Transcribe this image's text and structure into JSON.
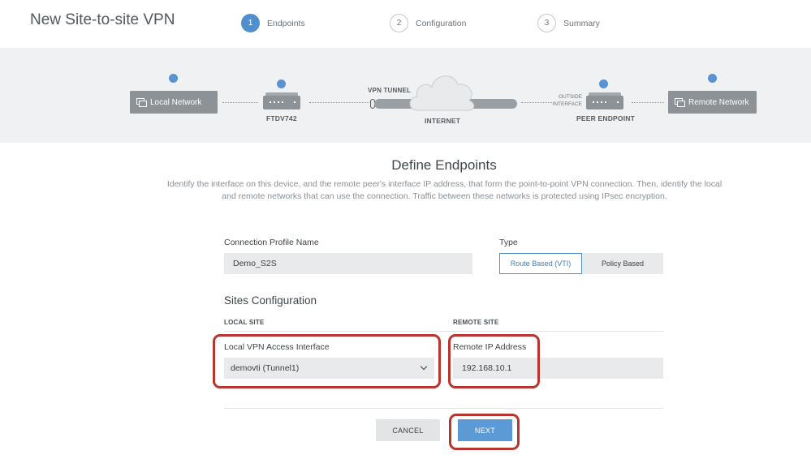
{
  "header": {
    "title": "New Site-to-site VPN",
    "steps": [
      {
        "number": "1",
        "label": "Endpoints",
        "active": true
      },
      {
        "number": "2",
        "label": "Configuration",
        "active": false
      },
      {
        "number": "3",
        "label": "Summary",
        "active": false
      }
    ]
  },
  "diagram": {
    "local_network": "Local Network",
    "local_device": "FTDV742",
    "tunnel_label": "VPN TUNNEL",
    "internet_label": "INTERNET",
    "outside_label_1": "OUTSIDE",
    "outside_label_2": "INTERFACE",
    "peer_label": "PEER ENDPOINT",
    "remote_network": "Remote Network"
  },
  "main": {
    "title": "Define Endpoints",
    "description": "Identify the interface on this device, and the remote peer's interface IP address, that form the point-to-point VPN connection. Then, identify the local and remote networks that can use the connection. Traffic between these networks is protected using IPsec encryption."
  },
  "form": {
    "profile_label": "Connection Profile Name",
    "profile_value": "Demo_S2S",
    "type_label": "Type",
    "type_options": [
      "Route Based (VTI)",
      "Policy Based"
    ],
    "type_selected": "Route Based (VTI)",
    "sites_title": "Sites Configuration",
    "local_site_header": "LOCAL SITE",
    "remote_site_header": "REMOTE SITE",
    "local_interface_label": "Local VPN Access Interface",
    "local_interface_value": "demovti (Tunnel1)",
    "remote_ip_label": "Remote IP Address",
    "remote_ip_value": "192.168.10.1"
  },
  "actions": {
    "cancel_label": "CANCEL",
    "next_label": "NEXT"
  },
  "colors": {
    "accent": "#4f8fcf",
    "highlight": "#b8342c"
  }
}
